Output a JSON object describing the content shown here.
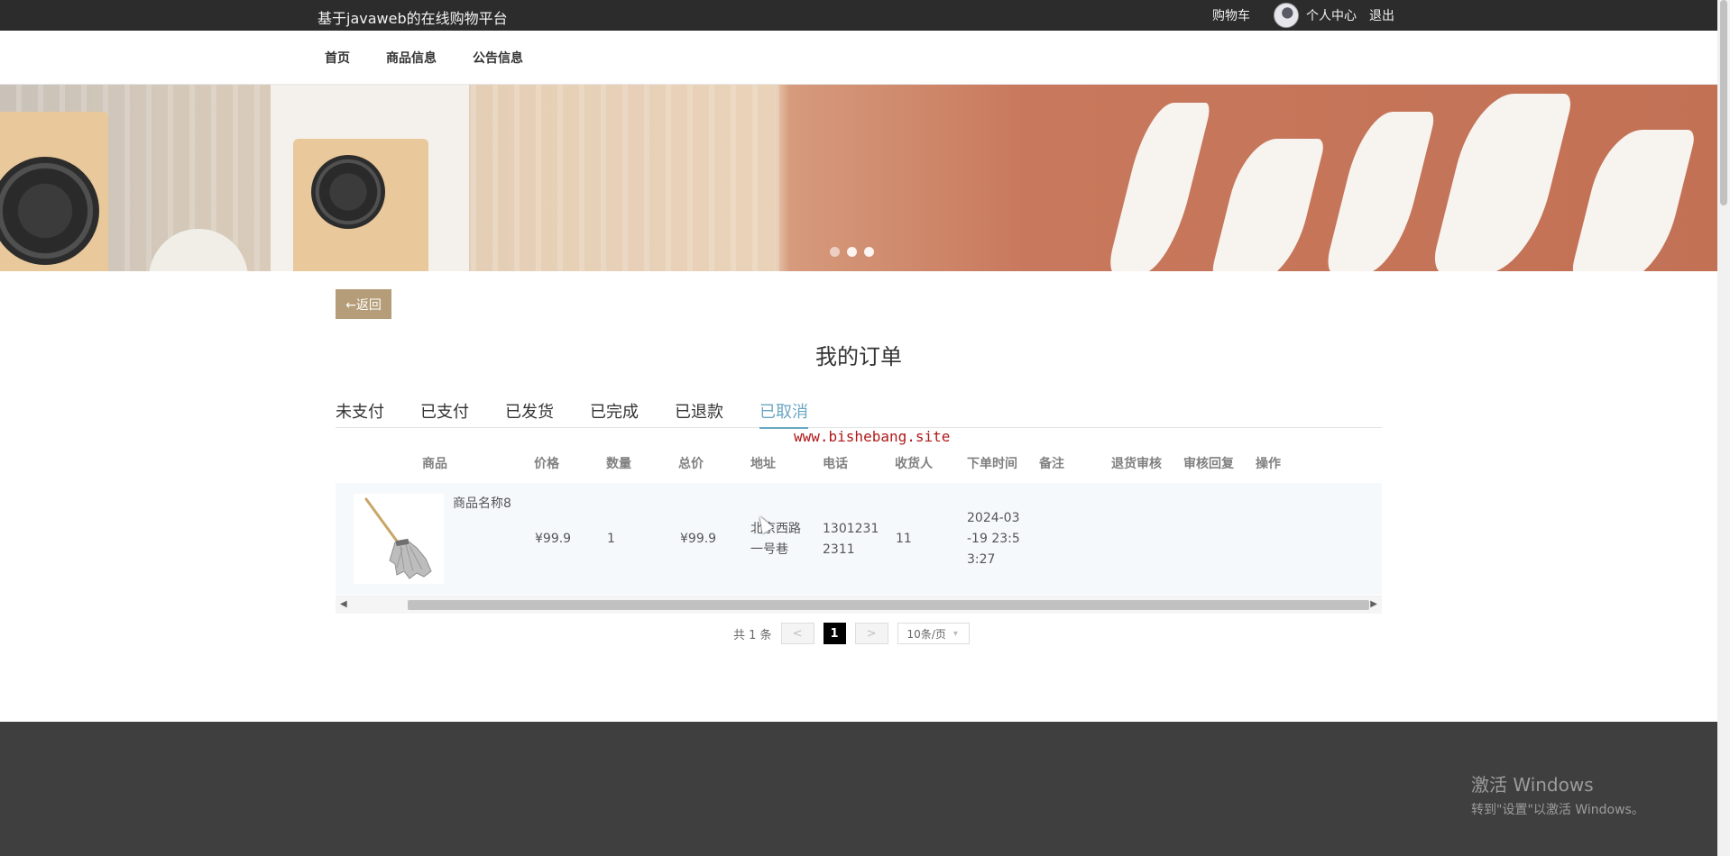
{
  "topbar": {
    "site_title": "基于javaweb的在线购物平台",
    "cart": "购物车",
    "profile": "个人中心",
    "logout": "退出"
  },
  "nav": {
    "items": [
      "首页",
      "商品信息",
      "公告信息"
    ]
  },
  "banner": {
    "slides": 3,
    "active_slide": 2
  },
  "back_button": "←返回",
  "page_title": "我的订单",
  "tabs": [
    {
      "label": "未支付",
      "active": false
    },
    {
      "label": "已支付",
      "active": false
    },
    {
      "label": "已发货",
      "active": false
    },
    {
      "label": "已完成",
      "active": false
    },
    {
      "label": "已退款",
      "active": false
    },
    {
      "label": "已取消",
      "active": true
    }
  ],
  "watermark": "www.bishebang.site",
  "table": {
    "headers": [
      "商品",
      "价格",
      "数量",
      "总价",
      "地址",
      "电话",
      "收货人",
      "下单时间",
      "备注",
      "退货审核",
      "审核回复",
      "操作"
    ],
    "rows": [
      {
        "product_name": "商品名称8",
        "price": "¥99.9",
        "quantity": "1",
        "total": "¥99.9",
        "address_line1": "北京西路",
        "address_line2": "一号巷",
        "phone_line1": "1301231",
        "phone_line2": "2311",
        "receiver": "11",
        "time_line1": "2024-03",
        "time_line2": "-19 23:5",
        "time_line3": "3:27",
        "note": "",
        "return_review": "",
        "review_reply": "",
        "action": ""
      }
    ]
  },
  "pagination": {
    "total": "共 1 条",
    "prev": "<",
    "current": "1",
    "next": ">",
    "page_size": "10条/页"
  },
  "windows_activation": {
    "title": "激活 Windows",
    "subtitle": "转到\"设置\"以激活 Windows。"
  },
  "colors": {
    "topbar_bg": "#2c2c2c",
    "accent_tab": "#6aa7c2",
    "back_button_bg": "#b49d78",
    "footer_bg": "#3f3f3f",
    "watermark": "#b01818"
  }
}
